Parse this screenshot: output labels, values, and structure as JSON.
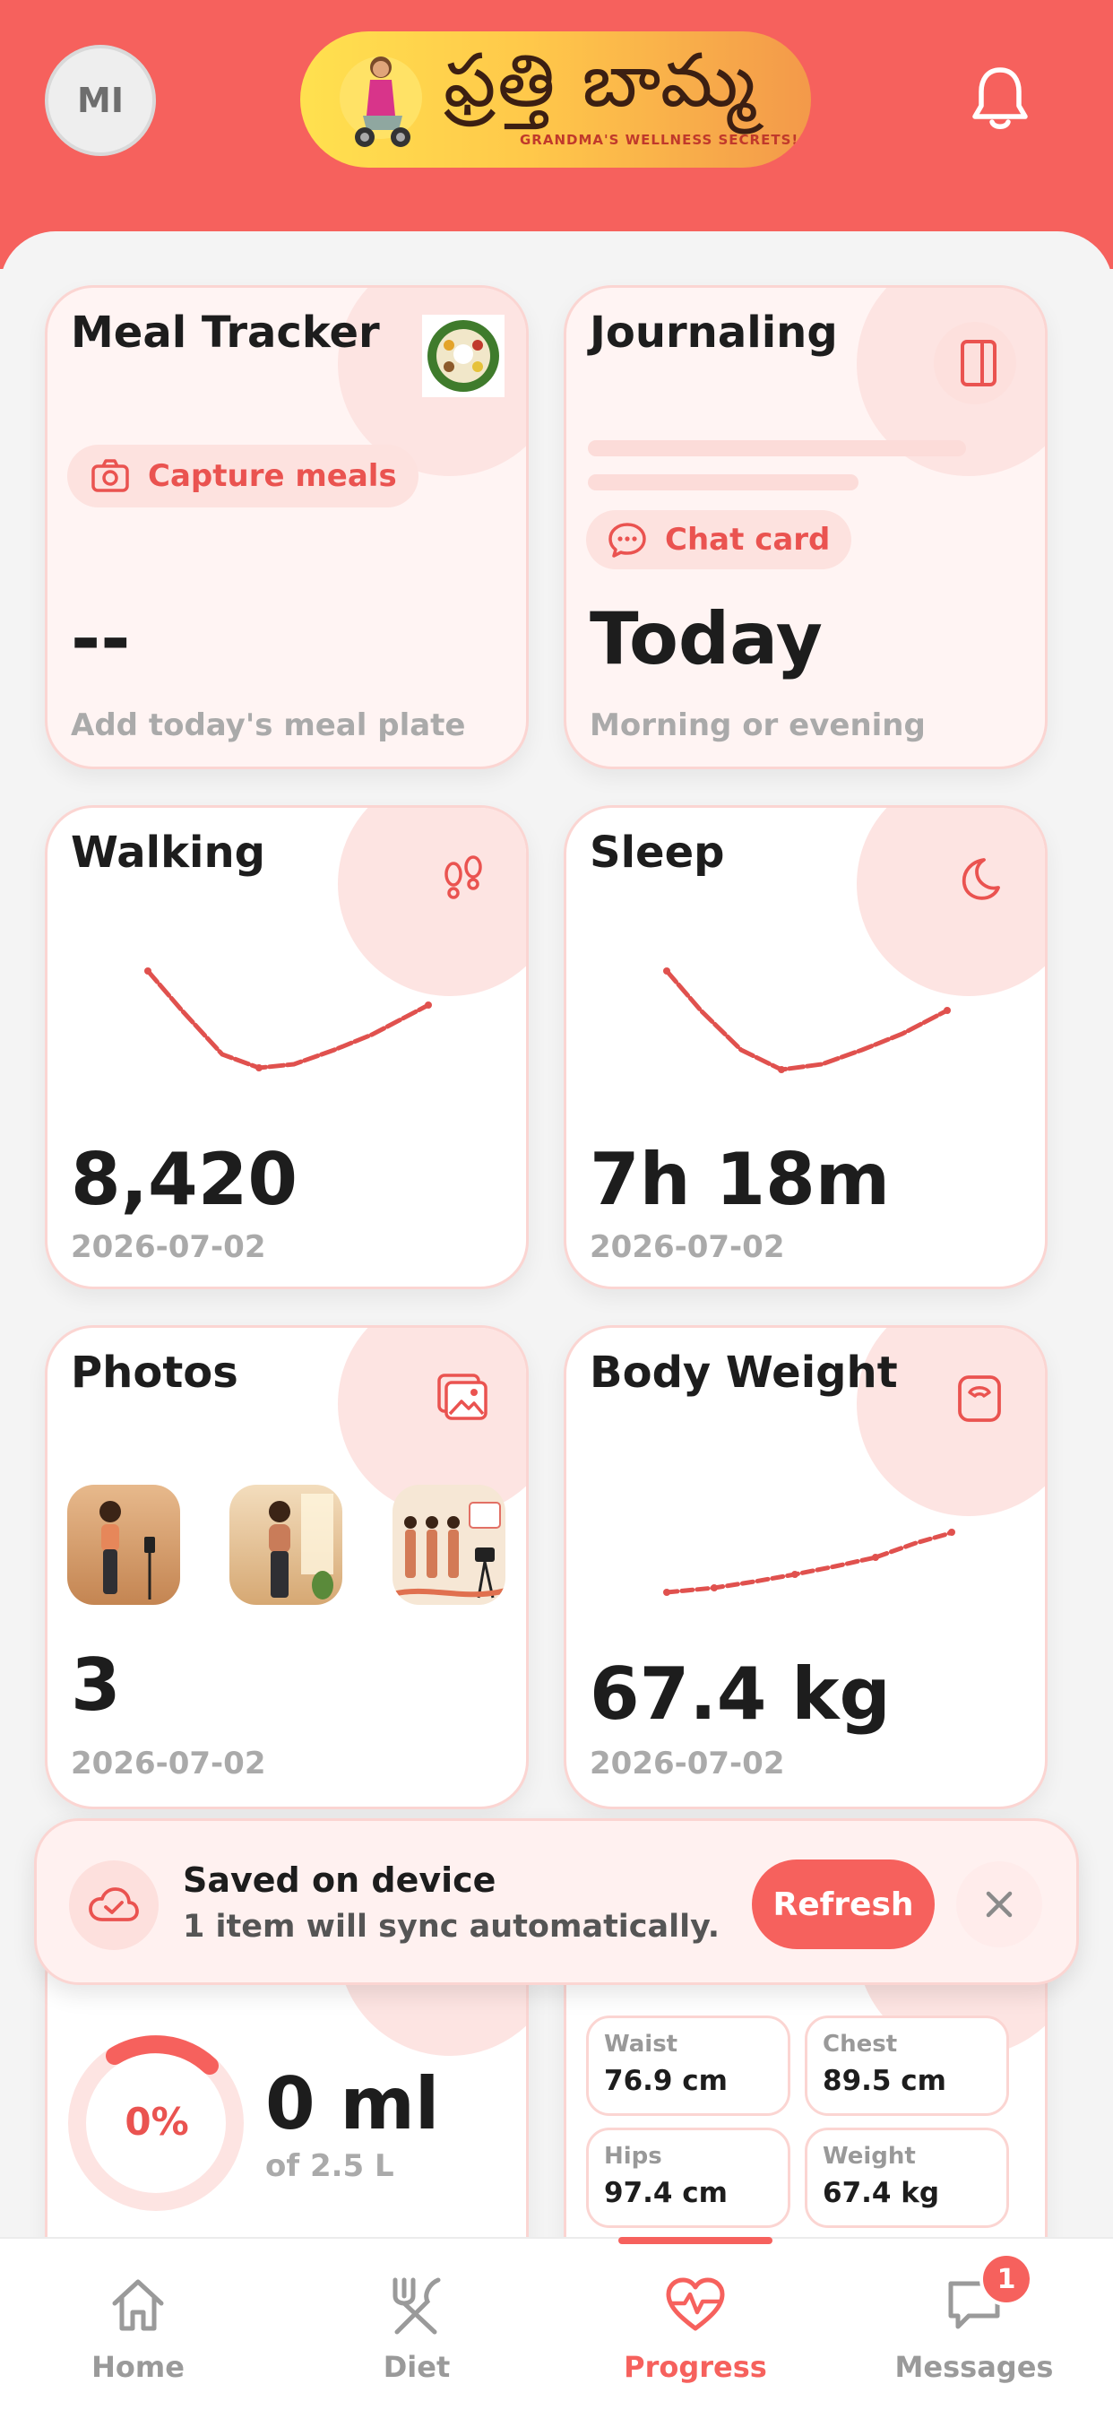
{
  "header": {
    "avatar_initials": "MI",
    "logo_text": "ఫ్రత్తి బామ్మ",
    "logo_tagline": "GRANDMA'S WELLNESS SECRETS!"
  },
  "cards": {
    "meal": {
      "title": "Meal Tracker",
      "action": "Capture meals",
      "value": "--",
      "subtitle": "Add today's meal plate"
    },
    "journal": {
      "title": "Journaling",
      "action": "Chat card",
      "value": "Today",
      "subtitle": "Morning or evening"
    },
    "walking": {
      "title": "Walking",
      "value": "8,420",
      "date": "2026-07-02"
    },
    "sleep": {
      "title": "Sleep",
      "value": "7h 18m",
      "date": "2026-07-02"
    },
    "photos": {
      "title": "Photos",
      "value": "3",
      "date": "2026-07-02"
    },
    "weight": {
      "title": "Body Weight",
      "value": "67.4 kg",
      "date": "2026-07-02"
    }
  },
  "toast": {
    "title": "Saved on device",
    "message": "1 item will sync automatically.",
    "refresh_label": "Refresh"
  },
  "water": {
    "percent_label": "0%",
    "amount": "0 ml",
    "goal": "of 2.5 L",
    "progress": 0
  },
  "measurements": [
    {
      "label": "Waist",
      "value": "76.9 cm"
    },
    {
      "label": "Chest",
      "value": "89.5 cm"
    },
    {
      "label": "Hips",
      "value": "97.4 cm"
    },
    {
      "label": "Weight",
      "value": "67.4 kg"
    }
  ],
  "nav": {
    "items": [
      {
        "label": "Home",
        "icon": "home-icon"
      },
      {
        "label": "Diet",
        "icon": "utensils-icon"
      },
      {
        "label": "Progress",
        "icon": "heart-pulse-icon"
      },
      {
        "label": "Messages",
        "icon": "chat-icon"
      }
    ],
    "active": "Progress",
    "messages_badge": "1"
  },
  "colors": {
    "accent": "#f6615d",
    "tint": "#fde4e2",
    "border": "#fbd5d2"
  }
}
